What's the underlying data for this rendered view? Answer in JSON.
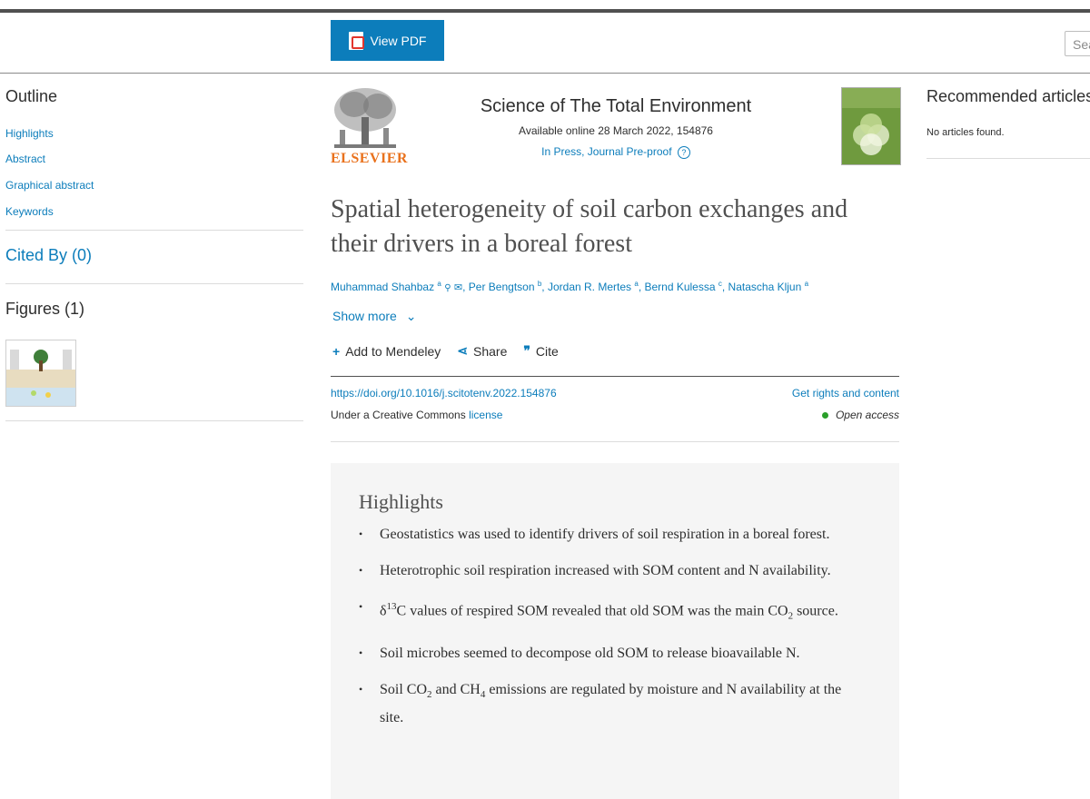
{
  "header": {
    "view_pdf_label": "View PDF",
    "search_placeholder": "Sea"
  },
  "outline": {
    "title": "Outline",
    "links": [
      "Highlights",
      "Abstract",
      "Graphical abstract",
      "Keywords"
    ],
    "cited_by": "Cited By (0)",
    "figures": "Figures (1)"
  },
  "journal": {
    "publisher": "ELSEVIER",
    "title": "Science of The Total Environment",
    "available": "Available online 28 March 2022, 154876",
    "status": "In Press, Journal Pre-proof",
    "help_icon": "?"
  },
  "article": {
    "title": "Spatial heterogeneity of soil carbon exchanges and their drivers in a boreal forest",
    "authors": [
      {
        "name": "Muhammad Shahbaz",
        "sup": "a"
      },
      {
        "name": "Per Bengtson",
        "sup": "b"
      },
      {
        "name": "Jordan R. Mertes",
        "sup": "a"
      },
      {
        "name": "Bernd Kulessa",
        "sup": "c"
      },
      {
        "name": "Natascha Kljun",
        "sup": "a"
      }
    ],
    "show_more": "Show more",
    "actions": {
      "mendeley": "Add to Mendeley",
      "share": "Share",
      "cite": "Cite"
    },
    "doi": "https://doi.org/10.1016/j.scitotenv.2022.154876",
    "rights": "Get rights and content",
    "license_prefix": "Under a Creative Commons",
    "license_link": "license",
    "open_access": "Open access"
  },
  "highlights": {
    "title": "Highlights",
    "items": [
      "Geostatistics was used to identify drivers of soil respiration in a boreal forest.",
      "Heterotrophic soil respiration increased with SOM content and N availability.",
      "δ13C values of respired SOM revealed that old SOM was the main CO2 source.",
      "Soil microbes seemed to decompose old SOM to release bioavailable N.",
      "Soil CO2 and CH4 emissions are regulated by moisture and N availability at the site."
    ]
  },
  "recommended": {
    "title": "Recommended articles",
    "empty": "No articles found."
  },
  "colors": {
    "accent": "#0c7dbb",
    "publisher_orange": "#e9711c",
    "open_access_green": "#2a9f2a",
    "highlight_bg": "#f5f5f5"
  }
}
